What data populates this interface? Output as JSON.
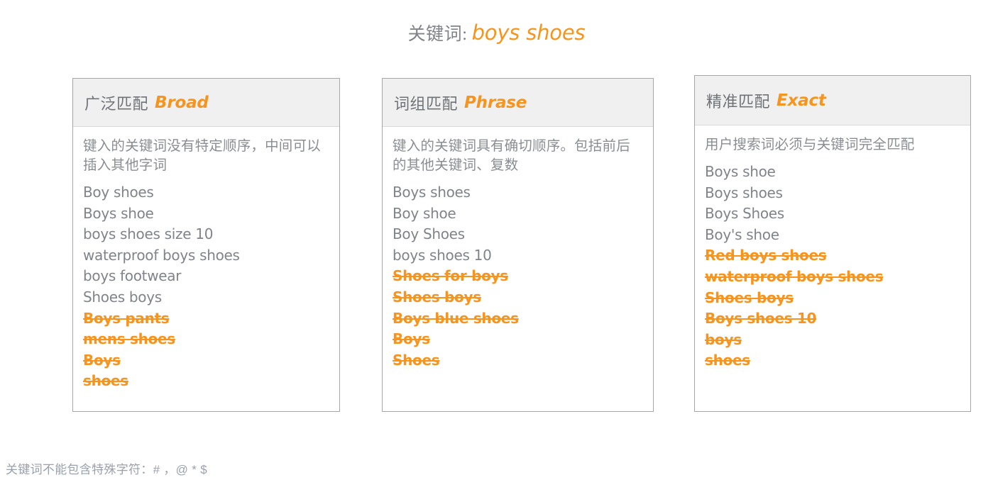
{
  "title": {
    "label_cn": "关键词:",
    "keyword": "boys shoes"
  },
  "cards": [
    {
      "id": "broad",
      "title_cn": "广泛匹配",
      "title_en": "Broad",
      "description": "键入的关键词没有特定顺序，中间可以插入其他字词",
      "included": [
        "Boy shoes",
        "Boys shoe",
        "boys shoes size 10",
        "waterproof boys shoes",
        "boys footwear",
        "Shoes boys"
      ],
      "excluded": [
        "Boys pants",
        "mens shoes",
        "Boys",
        "shoes"
      ]
    },
    {
      "id": "phrase",
      "title_cn": "词组匹配",
      "title_en": "Phrase",
      "description": "键入的关键词具有确切顺序。包括前后的其他关键词、复数",
      "included": [
        "Boys shoes",
        "Boy shoe",
        "Boy Shoes",
        "boys shoes 10"
      ],
      "excluded": [
        "Shoes for boys",
        "Shoes boys",
        "Boys blue shoes",
        "Boys",
        "Shoes"
      ]
    },
    {
      "id": "exact",
      "title_cn": "精准匹配",
      "title_en": "Exact",
      "description": "用户搜索词必须与关键词完全匹配",
      "included": [
        "Boys shoe",
        "Boys shoes",
        "Boys Shoes",
        "Boy's shoe"
      ],
      "excluded": [
        "Red boys shoes",
        "waterproof boys shoes",
        "Shoes boys",
        "Boys shoes 10",
        "boys",
        "shoes"
      ]
    }
  ],
  "footer": {
    "note": "关键词不能包含特殊字符：# ，@ *  $"
  },
  "colors": {
    "accent_orange": "#F7941D",
    "text_gray": "#80848a",
    "header_bg": "#f0f0f0",
    "card_border": "#a6a6a6"
  }
}
